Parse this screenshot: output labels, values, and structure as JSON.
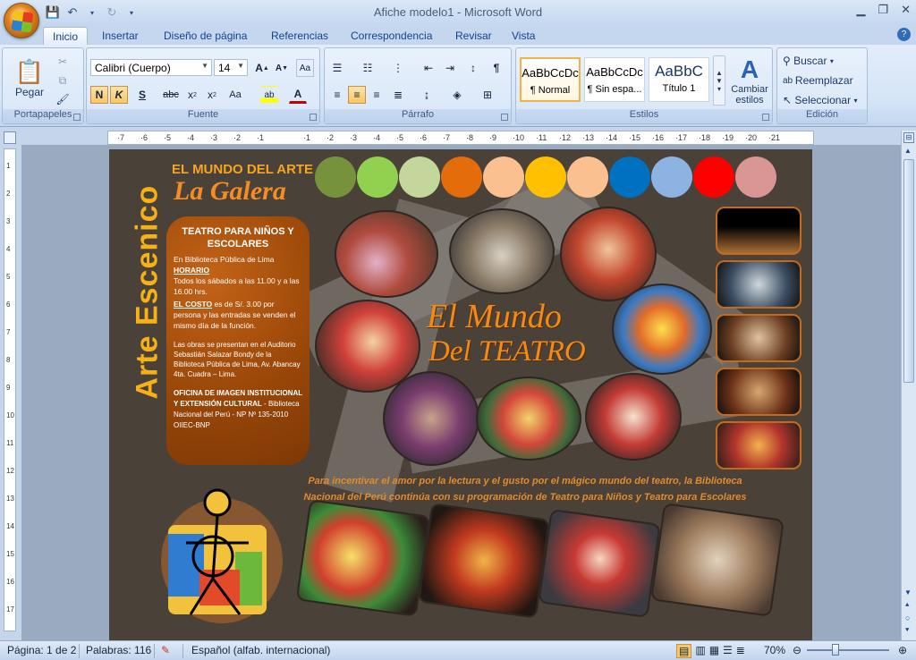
{
  "window": {
    "title": "Afiche modelo1 - Microsoft Word"
  },
  "tabs": [
    "Inicio",
    "Insertar",
    "Diseño de página",
    "Referencias",
    "Correspondencia",
    "Revisar",
    "Vista"
  ],
  "ribbon": {
    "clipboard": {
      "label": "Portapapeles",
      "paste": "Pegar"
    },
    "font": {
      "label": "Fuente",
      "font_name": "Calibri (Cuerpo)",
      "font_size": "14"
    },
    "paragraph": {
      "label": "Párrafo"
    },
    "styles": {
      "label": "Estilos",
      "items": [
        {
          "sample": "AaBbCcDc",
          "name": "¶ Normal"
        },
        {
          "sample": "AaBbCcDc",
          "name": "¶ Sin espa..."
        },
        {
          "sample": "AaBbC",
          "name": "Título 1"
        }
      ],
      "change": "Cambiar estilos"
    },
    "editing": {
      "label": "Edición",
      "find": "Buscar",
      "replace": "Reemplazar",
      "select": "Seleccionar"
    }
  },
  "ruler": {
    "h_ticks": [
      "·7",
      "·6",
      "·5",
      "·4",
      "·3",
      "·2",
      "·1",
      "",
      "·1",
      "·2",
      "·3",
      "·4",
      "·5",
      "·6",
      "·7",
      "·8",
      "·9",
      "·10",
      "·11",
      "·12",
      "·13",
      "·14",
      "·15",
      "·16",
      "·17",
      "·18",
      "·19",
      "·20",
      "·21"
    ],
    "v_ticks": [
      "1",
      "2",
      "3",
      "4",
      "5",
      "6",
      "7",
      "8",
      "9",
      "10",
      "11",
      "12",
      "13",
      "14",
      "15",
      "16",
      "17"
    ]
  },
  "poster": {
    "vertical_title": "Arte Escenico",
    "header_small": "EL MUNDO DEL ARTE",
    "header_big": "La Galera",
    "info_heading": "TEATRO PARA NIÑOS Y ESCOLARES",
    "info_line1": "En Biblioteca Pública de Lima",
    "info_horario_label": "HORARIO",
    "info_horario": "Todos los sábados a las 11.00 y a las 16.00 hrs.",
    "info_costo_label": "EL COSTO",
    "info_costo": " es de S/. 3.00 por persona y las entradas se venden el mismo día de la función.",
    "info_lugar": "Las obras se presentan en el Auditorio Sebastián Salazar Bondy de la Biblioteca Pública de Lima, Av. Abancay 4ta. Cuadra – Lima.",
    "info_oficina_label": "OFICINA DE IMAGEN INSTITUCIONAL Y EXTENSIÓN CULTURAL",
    "info_oficina": " - Biblioteca Nacional del Perú - NP Nº 135-2010 OIIEC-BNP",
    "teatro_title_1": "El Mundo",
    "teatro_title_2": "Del TEATRO",
    "caption": "Para incentivar el amor por la lectura y el gusto por el mágico mundo del teatro, la Biblioteca Nacional del Perú continúa con su programación de Teatro para Niños y Teatro para Escolares",
    "palette": [
      "#77923c",
      "#92d050",
      "#c3d69b",
      "#e46c0a",
      "#fac090",
      "#ffc000",
      "#fac090",
      "#0070c0",
      "#8db3e2",
      "#ff0000",
      "#d99694"
    ]
  },
  "status": {
    "page": "Página: 1 de 2",
    "words": "Palabras: 116",
    "language": "Español (alfab. internacional)",
    "zoom": "70%"
  }
}
